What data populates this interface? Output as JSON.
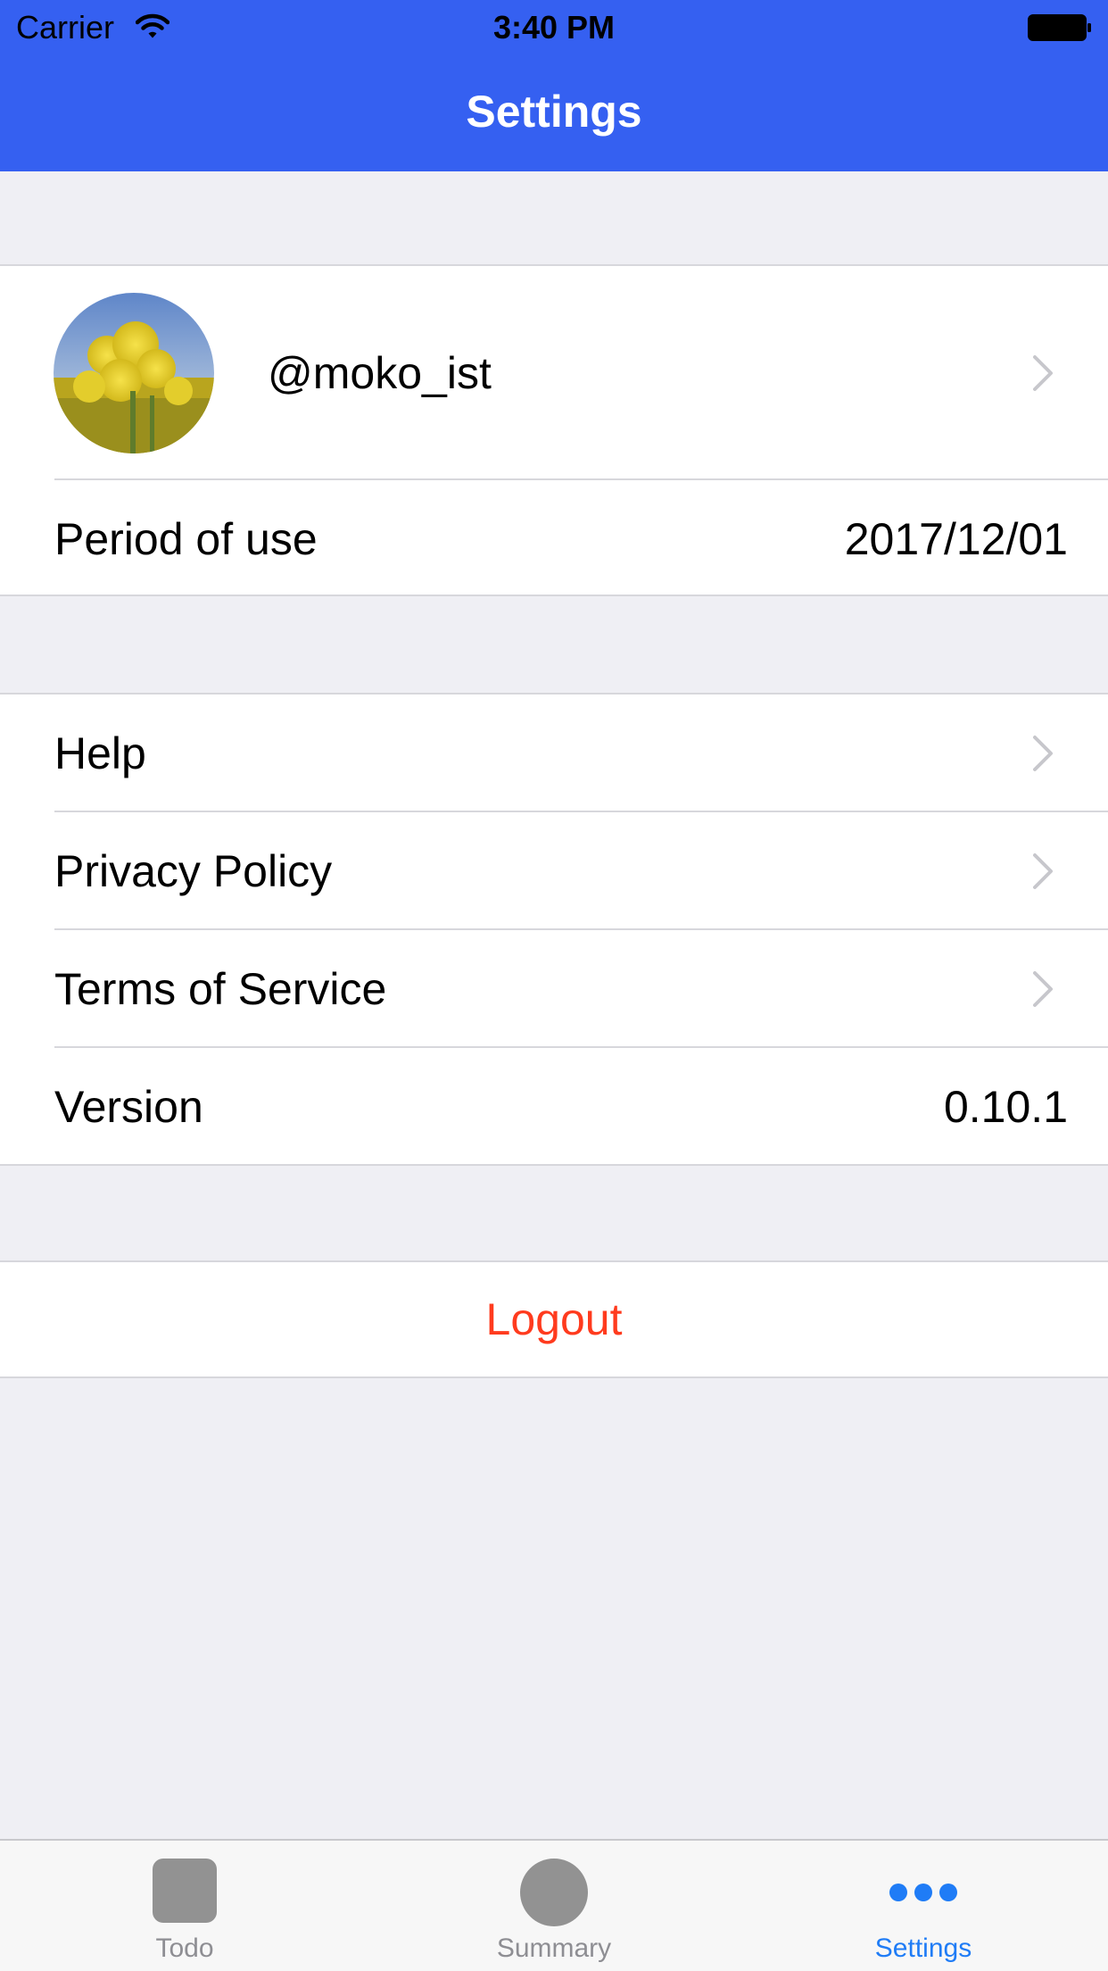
{
  "status_bar": {
    "carrier": "Carrier",
    "time": "3:40 PM"
  },
  "nav": {
    "title": "Settings"
  },
  "profile": {
    "username": "@moko_ist",
    "period_label": "Period of use",
    "period_value": "2017/12/01"
  },
  "menu": {
    "items": [
      {
        "label": "Help"
      },
      {
        "label": "Privacy Policy"
      },
      {
        "label": "Terms of Service"
      }
    ],
    "version_label": "Version",
    "version_value": "0.10.1"
  },
  "logout": {
    "label": "Logout"
  },
  "tabs": [
    {
      "label": "Todo",
      "icon": "rounded-square-icon",
      "active": false
    },
    {
      "label": "Summary",
      "icon": "circle-icon",
      "active": false
    },
    {
      "label": "Settings",
      "icon": "more-dots-icon",
      "active": true
    }
  ],
  "colors": {
    "nav_background": "#3560f1",
    "group_background": "#efeff4",
    "destructive": "#ff3b1e",
    "tab_active": "#1f7cf6",
    "tab_inactive": "#8e8e93"
  }
}
